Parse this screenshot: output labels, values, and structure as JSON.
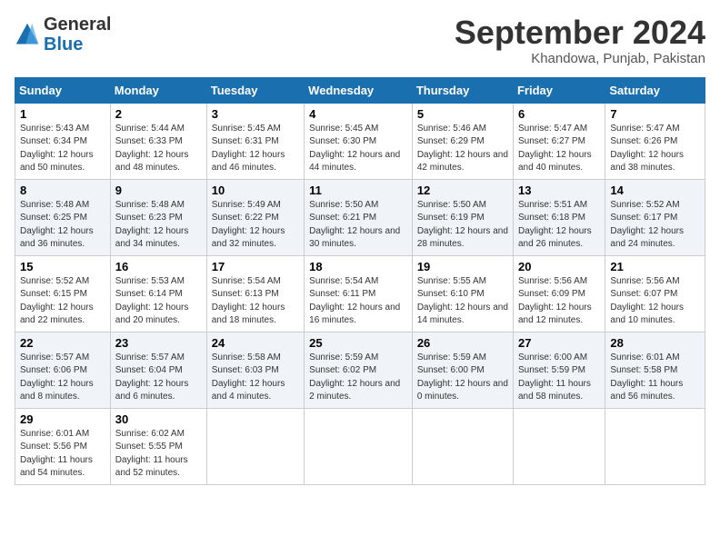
{
  "header": {
    "logo_line1": "General",
    "logo_line2": "Blue",
    "month_title": "September 2024",
    "location": "Khandowa, Punjab, Pakistan"
  },
  "days_of_week": [
    "Sunday",
    "Monday",
    "Tuesday",
    "Wednesday",
    "Thursday",
    "Friday",
    "Saturday"
  ],
  "weeks": [
    [
      {
        "day": 1,
        "sunrise": "5:43 AM",
        "sunset": "6:34 PM",
        "daylight": "12 hours and 50 minutes."
      },
      {
        "day": 2,
        "sunrise": "5:44 AM",
        "sunset": "6:33 PM",
        "daylight": "12 hours and 48 minutes."
      },
      {
        "day": 3,
        "sunrise": "5:45 AM",
        "sunset": "6:31 PM",
        "daylight": "12 hours and 46 minutes."
      },
      {
        "day": 4,
        "sunrise": "5:45 AM",
        "sunset": "6:30 PM",
        "daylight": "12 hours and 44 minutes."
      },
      {
        "day": 5,
        "sunrise": "5:46 AM",
        "sunset": "6:29 PM",
        "daylight": "12 hours and 42 minutes."
      },
      {
        "day": 6,
        "sunrise": "5:47 AM",
        "sunset": "6:27 PM",
        "daylight": "12 hours and 40 minutes."
      },
      {
        "day": 7,
        "sunrise": "5:47 AM",
        "sunset": "6:26 PM",
        "daylight": "12 hours and 38 minutes."
      }
    ],
    [
      {
        "day": 8,
        "sunrise": "5:48 AM",
        "sunset": "6:25 PM",
        "daylight": "12 hours and 36 minutes."
      },
      {
        "day": 9,
        "sunrise": "5:48 AM",
        "sunset": "6:23 PM",
        "daylight": "12 hours and 34 minutes."
      },
      {
        "day": 10,
        "sunrise": "5:49 AM",
        "sunset": "6:22 PM",
        "daylight": "12 hours and 32 minutes."
      },
      {
        "day": 11,
        "sunrise": "5:50 AM",
        "sunset": "6:21 PM",
        "daylight": "12 hours and 30 minutes."
      },
      {
        "day": 12,
        "sunrise": "5:50 AM",
        "sunset": "6:19 PM",
        "daylight": "12 hours and 28 minutes."
      },
      {
        "day": 13,
        "sunrise": "5:51 AM",
        "sunset": "6:18 PM",
        "daylight": "12 hours and 26 minutes."
      },
      {
        "day": 14,
        "sunrise": "5:52 AM",
        "sunset": "6:17 PM",
        "daylight": "12 hours and 24 minutes."
      }
    ],
    [
      {
        "day": 15,
        "sunrise": "5:52 AM",
        "sunset": "6:15 PM",
        "daylight": "12 hours and 22 minutes."
      },
      {
        "day": 16,
        "sunrise": "5:53 AM",
        "sunset": "6:14 PM",
        "daylight": "12 hours and 20 minutes."
      },
      {
        "day": 17,
        "sunrise": "5:54 AM",
        "sunset": "6:13 PM",
        "daylight": "12 hours and 18 minutes."
      },
      {
        "day": 18,
        "sunrise": "5:54 AM",
        "sunset": "6:11 PM",
        "daylight": "12 hours and 16 minutes."
      },
      {
        "day": 19,
        "sunrise": "5:55 AM",
        "sunset": "6:10 PM",
        "daylight": "12 hours and 14 minutes."
      },
      {
        "day": 20,
        "sunrise": "5:56 AM",
        "sunset": "6:09 PM",
        "daylight": "12 hours and 12 minutes."
      },
      {
        "day": 21,
        "sunrise": "5:56 AM",
        "sunset": "6:07 PM",
        "daylight": "12 hours and 10 minutes."
      }
    ],
    [
      {
        "day": 22,
        "sunrise": "5:57 AM",
        "sunset": "6:06 PM",
        "daylight": "12 hours and 8 minutes."
      },
      {
        "day": 23,
        "sunrise": "5:57 AM",
        "sunset": "6:04 PM",
        "daylight": "12 hours and 6 minutes."
      },
      {
        "day": 24,
        "sunrise": "5:58 AM",
        "sunset": "6:03 PM",
        "daylight": "12 hours and 4 minutes."
      },
      {
        "day": 25,
        "sunrise": "5:59 AM",
        "sunset": "6:02 PM",
        "daylight": "12 hours and 2 minutes."
      },
      {
        "day": 26,
        "sunrise": "5:59 AM",
        "sunset": "6:00 PM",
        "daylight": "12 hours and 0 minutes."
      },
      {
        "day": 27,
        "sunrise": "6:00 AM",
        "sunset": "5:59 PM",
        "daylight": "11 hours and 58 minutes."
      },
      {
        "day": 28,
        "sunrise": "6:01 AM",
        "sunset": "5:58 PM",
        "daylight": "11 hours and 56 minutes."
      }
    ],
    [
      {
        "day": 29,
        "sunrise": "6:01 AM",
        "sunset": "5:56 PM",
        "daylight": "11 hours and 54 minutes."
      },
      {
        "day": 30,
        "sunrise": "6:02 AM",
        "sunset": "5:55 PM",
        "daylight": "11 hours and 52 minutes."
      },
      null,
      null,
      null,
      null,
      null
    ]
  ]
}
